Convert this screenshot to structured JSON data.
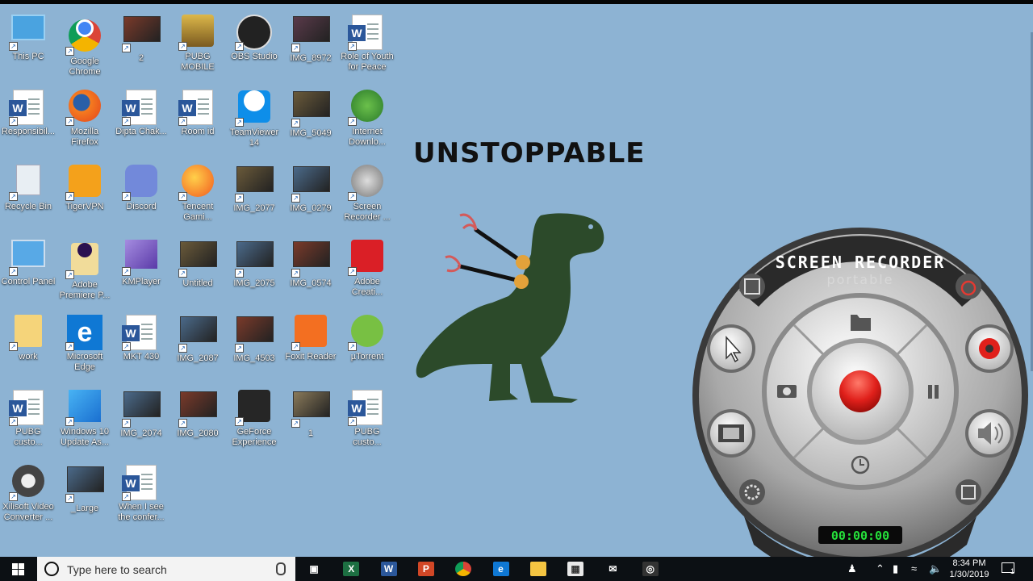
{
  "desktop": {
    "headline": "UNSTOPPABLE",
    "icons": [
      {
        "label": "This PC",
        "icon": "this-pc-icon"
      },
      {
        "label": "Google Chrome",
        "icon": "chrome-icon"
      },
      {
        "label": "2",
        "icon": "photo-icon"
      },
      {
        "label": "PUBG MOBILE",
        "icon": "pubg-icon"
      },
      {
        "label": "OBS Studio",
        "icon": "obs-icon"
      },
      {
        "label": "IMG_8972",
        "icon": "photo-icon"
      },
      {
        "label": "Role of Youth for Peace",
        "icon": "word-doc-icon"
      },
      {
        "label": "Responsibil...",
        "icon": "word-doc-icon"
      },
      {
        "label": "Mozilla Firefox",
        "icon": "firefox-icon"
      },
      {
        "label": "Dipta Chak...",
        "icon": "word-doc-icon"
      },
      {
        "label": "Room id",
        "icon": "word-doc-icon"
      },
      {
        "label": "TeamViewer 14",
        "icon": "teamviewer-icon"
      },
      {
        "label": "IMG_5049",
        "icon": "photo-icon"
      },
      {
        "label": "Internet Downlo...",
        "icon": "idm-icon"
      },
      {
        "label": "Recycle Bin",
        "icon": "recycle-bin-icon"
      },
      {
        "label": "TigerVPN",
        "icon": "tigervpn-icon"
      },
      {
        "label": "Discord",
        "icon": "discord-icon"
      },
      {
        "label": "Tencent Gami...",
        "icon": "tencent-icon"
      },
      {
        "label": "IMG_2077",
        "icon": "photo-icon"
      },
      {
        "label": "IMG_0279",
        "icon": "photo-icon"
      },
      {
        "label": "Screen Recorder ...",
        "icon": "screen-recorder-icon"
      },
      {
        "label": "Control Panel",
        "icon": "control-panel-icon"
      },
      {
        "label": "Adobe Premiere P...",
        "icon": "premiere-icon"
      },
      {
        "label": "KMPlayer",
        "icon": "kmplayer-icon"
      },
      {
        "label": "Untitled",
        "icon": "photo-icon"
      },
      {
        "label": "IMG_2075",
        "icon": "photo-icon"
      },
      {
        "label": "IMG_0574",
        "icon": "photo-icon"
      },
      {
        "label": "Adobe Creati...",
        "icon": "adobe-cc-icon"
      },
      {
        "label": "work",
        "icon": "folder-icon"
      },
      {
        "label": "Microsoft Edge",
        "icon": "edge-icon"
      },
      {
        "label": "MKT 430",
        "icon": "word-doc-icon"
      },
      {
        "label": "IMG_2087",
        "icon": "photo-icon"
      },
      {
        "label": "IMG_4503",
        "icon": "photo-icon"
      },
      {
        "label": "Foxit Reader",
        "icon": "foxit-icon"
      },
      {
        "label": "µTorrent",
        "icon": "utorrent-icon"
      },
      {
        "label": "PUBG custo...",
        "icon": "word-doc-icon"
      },
      {
        "label": "Windows 10 Update As...",
        "icon": "windows-update-icon"
      },
      {
        "label": "IMG_2074",
        "icon": "photo-icon"
      },
      {
        "label": "IMG_2080",
        "icon": "photo-icon"
      },
      {
        "label": "GeForce Experience",
        "icon": "geforce-icon"
      },
      {
        "label": "1",
        "icon": "photo-icon"
      },
      {
        "label": "PUBG custo...",
        "icon": "word-doc-icon"
      },
      {
        "label": "Xilisoft Video Converter ...",
        "icon": "xilisoft-icon"
      },
      {
        "label": "_Large",
        "icon": "photo-icon"
      },
      {
        "label": "When I see the confer...",
        "icon": "word-doc-icon"
      }
    ]
  },
  "recorder": {
    "title": "SCREEN RECORDER",
    "subtitle": "portable",
    "timer": "00:00:00"
  },
  "taskbar": {
    "search_placeholder": "Type here to search",
    "time": "8:34 PM",
    "date": "1/30/2019",
    "notification_count": "1",
    "pinned": [
      "task-view-icon",
      "excel-icon",
      "word-icon",
      "powerpoint-icon",
      "chrome-icon",
      "edge-icon",
      "file-explorer-icon",
      "store-icon",
      "mail-icon",
      "obs-icon"
    ]
  },
  "colors": {
    "desktop_bg": "#8db3d3",
    "taskbar_bg": "#0c1014",
    "record_red": "#e0201b",
    "timer_green": "#25e03a",
    "dino_green": "#2c4a2a"
  }
}
